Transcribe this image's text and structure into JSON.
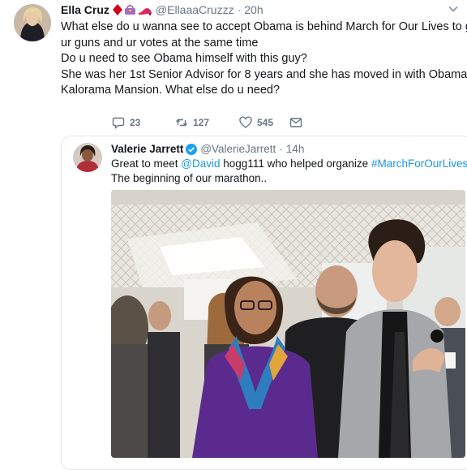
{
  "tweet": {
    "author_name": "Ella Cruz",
    "author_emoji": [
      "red-diamond",
      "purse",
      "high-heel"
    ],
    "handle": "@EllaaaCruzzz",
    "separator": "·",
    "time": "20h",
    "lines": [
      "What else do u wanna see to accept Obama is behind March for Our Lives to grab",
      "ur guns and ur votes at the same time",
      "Do u need to see Obama himself with this guy?",
      "She was her 1st Senior Advisor for 8 years and she has moved in with Obama in",
      "Kalorama Mansion. What else do u need?"
    ],
    "actions": {
      "reply_count": "23",
      "retweet_count": "127",
      "like_count": "545"
    }
  },
  "quoted": {
    "author_name": "Valerie Jarrett",
    "handle": "@ValerieJarrett",
    "separator": "·",
    "time": "14h",
    "line1_prefix": "Great to meet ",
    "mention": "@David",
    "line1_middle": " hogg111 who helped organize ",
    "hashtag": "#MarchForOurLives",
    "hashtag_emoji": "👪👪",
    "line1_suffix": ".",
    "line2": "The beginning of our marathon.."
  },
  "colors": {
    "link": "#1b95e0",
    "secondary_text": "#657786",
    "border": "#e1e8ed"
  }
}
